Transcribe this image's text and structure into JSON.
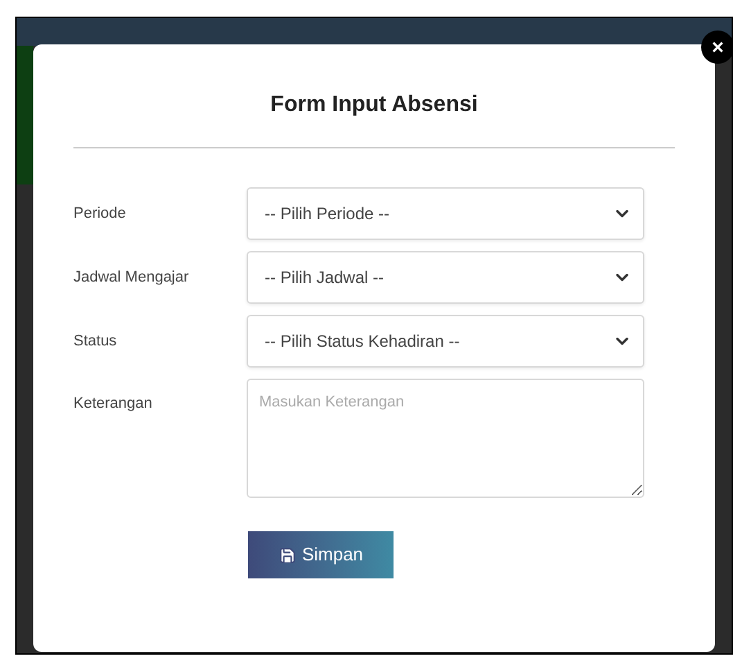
{
  "modal": {
    "title": "Form Input Absensi",
    "close": "×"
  },
  "fields": [
    {
      "kind": "select",
      "label": "Periode",
      "value": "-- Pilih Periode --"
    },
    {
      "kind": "select",
      "label": "Jadwal Mengajar",
      "value": "-- Pilih Jadwal --"
    },
    {
      "kind": "select",
      "label": "Status",
      "value": "-- Pilih Status Kehadiran --"
    },
    {
      "kind": "textarea",
      "label": "Keterangan",
      "placeholder": "Masukan Keterangan"
    }
  ],
  "submit": {
    "label": "Simpan"
  }
}
